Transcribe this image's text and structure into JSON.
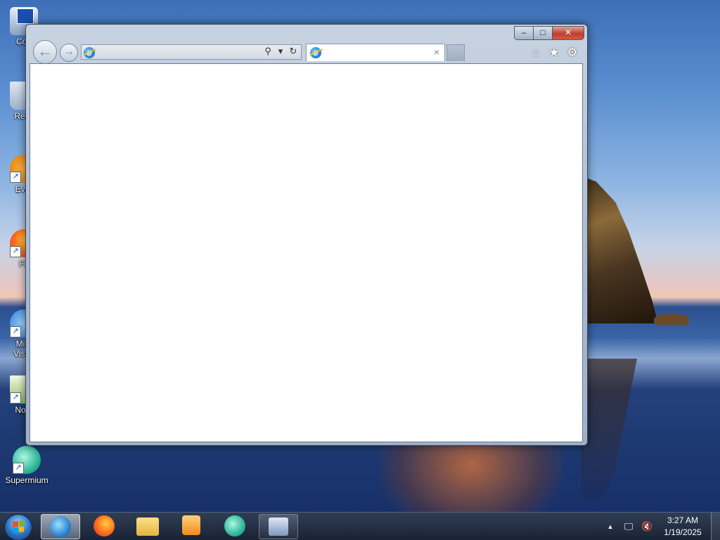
{
  "desktop": {
    "icons": [
      {
        "label": "Con",
        "icon": "computer-icon"
      },
      {
        "label": "Recy",
        "icon": "recycle-bin-icon"
      },
      {
        "label": "Ever",
        "icon": "everything-icon"
      },
      {
        "label": "Fir",
        "icon": "firefox-icon"
      },
      {
        "label": "Micr",
        "label2": "Visua",
        "icon": "visual-studio-icon"
      },
      {
        "label": "Note",
        "icon": "notepad-icon"
      },
      {
        "label": "Supermium",
        "icon": "supermium-icon"
      }
    ]
  },
  "ie_window": {
    "caption": {
      "minimize": "–",
      "maximize": "□",
      "close": "✕"
    },
    "nav": {
      "back": "←",
      "forward": "→"
    },
    "address": {
      "value": "",
      "placeholder": ""
    },
    "address_tools": {
      "search": "⚲",
      "dropdown": "▾",
      "refresh": "↻"
    },
    "tab": {
      "title": "",
      "close": "×"
    },
    "commands": {
      "home": "⌂",
      "favorites": "★",
      "tools": "⚙"
    }
  },
  "taskbar": {
    "apps": [
      {
        "name": "Internet Explorer",
        "icon": "internet-explorer-icon",
        "state": "active"
      },
      {
        "name": "Firefox",
        "icon": "firefox-icon",
        "state": "idle"
      },
      {
        "name": "File Explorer",
        "icon": "folder-icon",
        "state": "idle"
      },
      {
        "name": "Media Player",
        "icon": "media-player-icon",
        "state": "idle"
      },
      {
        "name": "Supermium",
        "icon": "supermium-icon",
        "state": "idle"
      },
      {
        "name": "Remote Desktop",
        "icon": "remote-desktop-icon",
        "state": "open"
      }
    ],
    "tray": {
      "overflow": "▲",
      "network": "🖵",
      "volume": "🔇",
      "time": "3:27 AM",
      "date": "1/19/2025"
    }
  },
  "colors": {
    "accent": "#1f77c9",
    "close_red": "#c43b2c",
    "window_frame": "#a9b9cf"
  }
}
